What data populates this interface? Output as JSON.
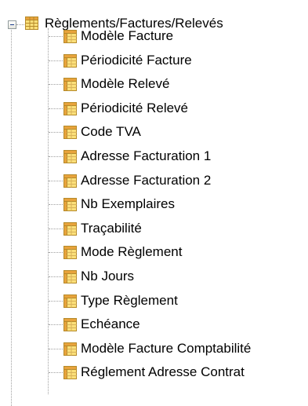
{
  "tree": {
    "root": {
      "label": "Règlements/Factures/Relevés",
      "icon": "table-folder-icon",
      "expanded": true
    },
    "items": [
      {
        "label": "Modèle Facture",
        "icon": "table-icon"
      },
      {
        "label": "Périodicité Facture",
        "icon": "table-icon"
      },
      {
        "label": "Modèle Relevé",
        "icon": "table-icon"
      },
      {
        "label": "Périodicité Relevé",
        "icon": "table-icon"
      },
      {
        "label": "Code TVA",
        "icon": "table-icon"
      },
      {
        "label": "Adresse Facturation 1",
        "icon": "table-icon"
      },
      {
        "label": "Adresse Facturation 2",
        "icon": "table-icon"
      },
      {
        "label": "Nb Exemplaires",
        "icon": "table-icon"
      },
      {
        "label": "Traçabilité",
        "icon": "table-icon"
      },
      {
        "label": "Mode Règlement",
        "icon": "table-icon"
      },
      {
        "label": "Nb Jours",
        "icon": "table-icon"
      },
      {
        "label": "Type Règlement",
        "icon": "table-icon"
      },
      {
        "label": "Echéance",
        "icon": "table-icon"
      },
      {
        "label": "Modèle Facture Comptabilité",
        "icon": "table-icon"
      },
      {
        "label": "Réglement Adresse Contrat",
        "icon": "table-icon"
      }
    ]
  },
  "colors": {
    "dotted_line": "#a0a0a0",
    "icon_header": "#e8a33c",
    "icon_cells": "#fbe07a",
    "background": "#ffffff"
  }
}
